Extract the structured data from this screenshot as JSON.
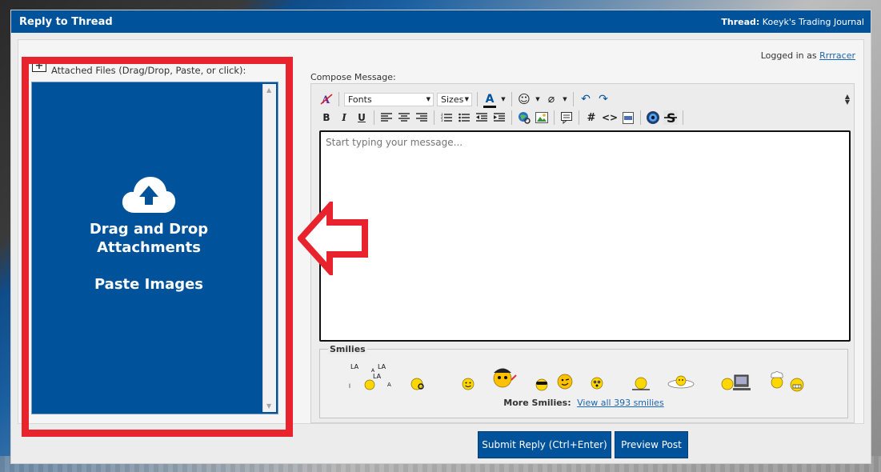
{
  "header": {
    "title": "Reply to Thread",
    "thread_label": "Thread:",
    "thread_name": "Koeyk's Trading Journal"
  },
  "account": {
    "logged_in_text": "Logged in as",
    "username": "Rrrracer"
  },
  "attachments": {
    "label": "Attached Files (Drag/Drop, Paste, or click):",
    "drop_line1": "Drag and Drop",
    "drop_line2": "Attachments",
    "drop_line3": "Paste Images"
  },
  "compose": {
    "label": "Compose Message:",
    "fonts_select": "Fonts",
    "sizes_select": "Sizes",
    "placeholder": "Start typing your message...",
    "toolbar": {
      "bold": "B",
      "italic": "I",
      "underline": "U",
      "hash": "#",
      "code": "<>"
    }
  },
  "smilies": {
    "legend": "Smilies",
    "more_label": "More Smilies:",
    "view_all_link": "View all 393 smilies",
    "la_text": "LA"
  },
  "actions": {
    "submit_label": "Submit Reply (Ctrl+Enter)",
    "preview_label": "Preview Post"
  },
  "colors": {
    "brand_blue": "#00529b",
    "annotation_red": "#e8232d"
  }
}
